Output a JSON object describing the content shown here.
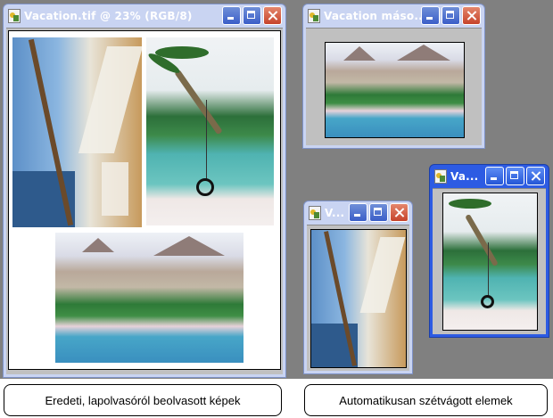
{
  "windows": {
    "original": {
      "title": "Vacation.tif @ 23% (RGB/8)",
      "icon": "image-file-icon"
    },
    "copy1": {
      "title": "Vacation máso..."
    },
    "copy2": {
      "title": "Va..."
    },
    "copy3": {
      "title": "V..."
    }
  },
  "window_buttons": {
    "minimize": "minimize-icon",
    "maximize": "maximize-icon",
    "close": "close-icon"
  },
  "captions": {
    "left": "Eredeti, lapolvasóról beolvasott képek",
    "right": "Automatikusan szétvágott elemek"
  },
  "colors": {
    "desktop": "#808080",
    "titlebar_active": "#2d5be3",
    "titlebar_inactive": "#c9d4f2"
  }
}
